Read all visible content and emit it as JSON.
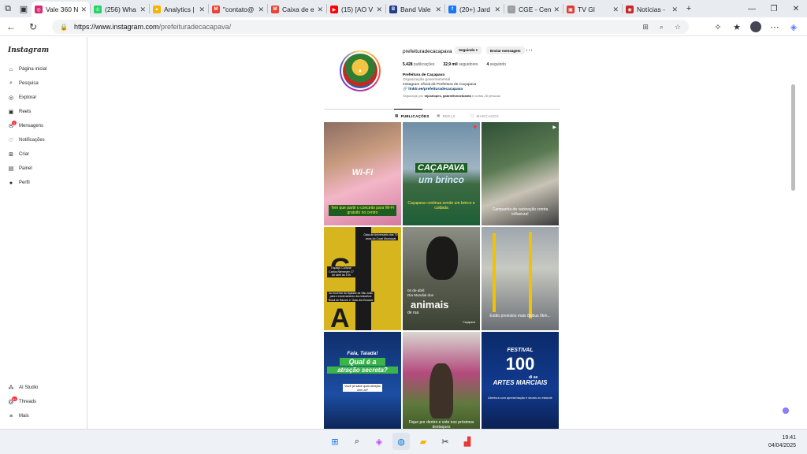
{
  "browser": {
    "tabs": [
      {
        "label": "Vale 360 N",
        "color": "#d62976",
        "glyph": "◎",
        "active": true
      },
      {
        "label": "(256) Wha",
        "color": "#25d366",
        "glyph": "✆",
        "active": false
      },
      {
        "label": "Analytics |",
        "color": "#f4b400",
        "glyph": "▲",
        "active": false
      },
      {
        "label": "\"contato@",
        "color": "#ea4335",
        "glyph": "M",
        "active": false
      },
      {
        "label": "Caixa de e",
        "color": "#ea4335",
        "glyph": "M",
        "active": false
      },
      {
        "label": "(15) [AO V",
        "color": "#ff0000",
        "glyph": "▶",
        "active": false
      },
      {
        "label": "Band Vale",
        "color": "#1f3b8a",
        "glyph": "B",
        "active": false
      },
      {
        "label": "(20+) Jard",
        "color": "#1877f2",
        "glyph": "f",
        "active": false
      },
      {
        "label": "CGE - Cen",
        "color": "#9e9e9e",
        "glyph": "◌",
        "active": false
      },
      {
        "label": "TV Gl",
        "color": "#e53935",
        "glyph": "▣",
        "active": false
      },
      {
        "label": "Notícias -",
        "color": "#c62828",
        "glyph": "◉",
        "active": false
      }
    ],
    "new_tab": "+",
    "url_host": "https://www.instagram.com",
    "url_path": "/prefeituradecacapava/"
  },
  "sidebar": {
    "logo": "Instagram",
    "items": [
      {
        "label": "Página inicial",
        "icon": "⌂"
      },
      {
        "label": "Pesquisa",
        "icon": "⌕"
      },
      {
        "label": "Explorar",
        "icon": "◎"
      },
      {
        "label": "Reels",
        "icon": "▣"
      },
      {
        "label": "Mensagens",
        "icon": "✉",
        "badge": "1"
      },
      {
        "label": "Notificações",
        "icon": "♡"
      },
      {
        "label": "Criar",
        "icon": "⊞"
      },
      {
        "label": "Painel",
        "icon": "▤"
      },
      {
        "label": "Perfil",
        "icon": "●"
      }
    ],
    "bottom_items": [
      {
        "label": "AI Studio",
        "icon": "⁂"
      },
      {
        "label": "Threads",
        "icon": "@",
        "badge": "9+"
      },
      {
        "label": "Mais",
        "icon": "≡"
      }
    ]
  },
  "profile": {
    "username": "prefeituradecacapava",
    "following_button": "Seguindo ▾",
    "message_button": "Enviar mensagem",
    "more": "···",
    "stats": {
      "posts_value": "5.428",
      "posts_label": "publicações",
      "followers_value": "32,9 mil",
      "followers_label": "seguidores",
      "following_value": "4",
      "following_label": "seguindo"
    },
    "bio_name": "Prefeitura de Caçapava",
    "bio_category": "Organização governamental",
    "bio_text": "Instagram oficial da Prefeitura de Caçapava",
    "bio_link": "🔗 linktr.ee/prefeituradecacapava",
    "followed_by_prefix": "Seguido(a) por ",
    "followed_by_names": "mjcarlopes, gabrielfonsetuanta",
    "followed_by_suffix": " e outras 28 pessoas",
    "tabs": [
      {
        "label": "PUBLICAÇÕES",
        "icon": "▦"
      },
      {
        "label": "REELS",
        "icon": "▣"
      },
      {
        "label": "MARCADOS",
        "icon": "▢"
      }
    ]
  },
  "posts": {
    "p1": {
      "title": "Wi-Fi",
      "caption": "Tem que partir o conceito para Wi-Fi gratuito no centro"
    },
    "p2": {
      "title1": "CAÇAPAVA",
      "title2": "um brinco",
      "caption": "Caçapava continua sendo um brinco e cuidada"
    },
    "p3": {
      "caption": "Campanha de vacinação contra influenza!"
    },
    "p4": {
      "letters": "G A L A",
      "title": "Gala de Aniversário dos 70 anos do Coral Municipal",
      "info": "Espaço Cultural Carlos Niemeyer 17 de abril às 19h",
      "desc": "Ao encerrar do repasse de São João para o encerramento dos trabalhos 'Brasil de Raízes' e 'Gala dos Ensaios'"
    },
    "p5": {
      "date": "04 de abril",
      "line": "Dia Mundial dos",
      "title": "animais",
      "sub": "de rua",
      "brand": "Caçapava"
    },
    "p6": {
      "caption": "Estão previstos mais ônibus 0km..."
    },
    "p7": {
      "line1": "Fala, Taiada!",
      "line2": "Qual é a",
      "line3": "atração secreta?",
      "sub": "Você já sabe qual atração vem aí?"
    },
    "p8": {
      "caption": "Fique por dentro e vote nos próximos destaques"
    },
    "p9": {
      "festival": "FESTIVAL",
      "num": "100",
      "dias": "di as",
      "title": "ARTES MARCIAIS",
      "sub": "Abertura com apresentação e shows no estande"
    }
  },
  "system": {
    "time": "19:41",
    "date": "04/04/2025"
  }
}
